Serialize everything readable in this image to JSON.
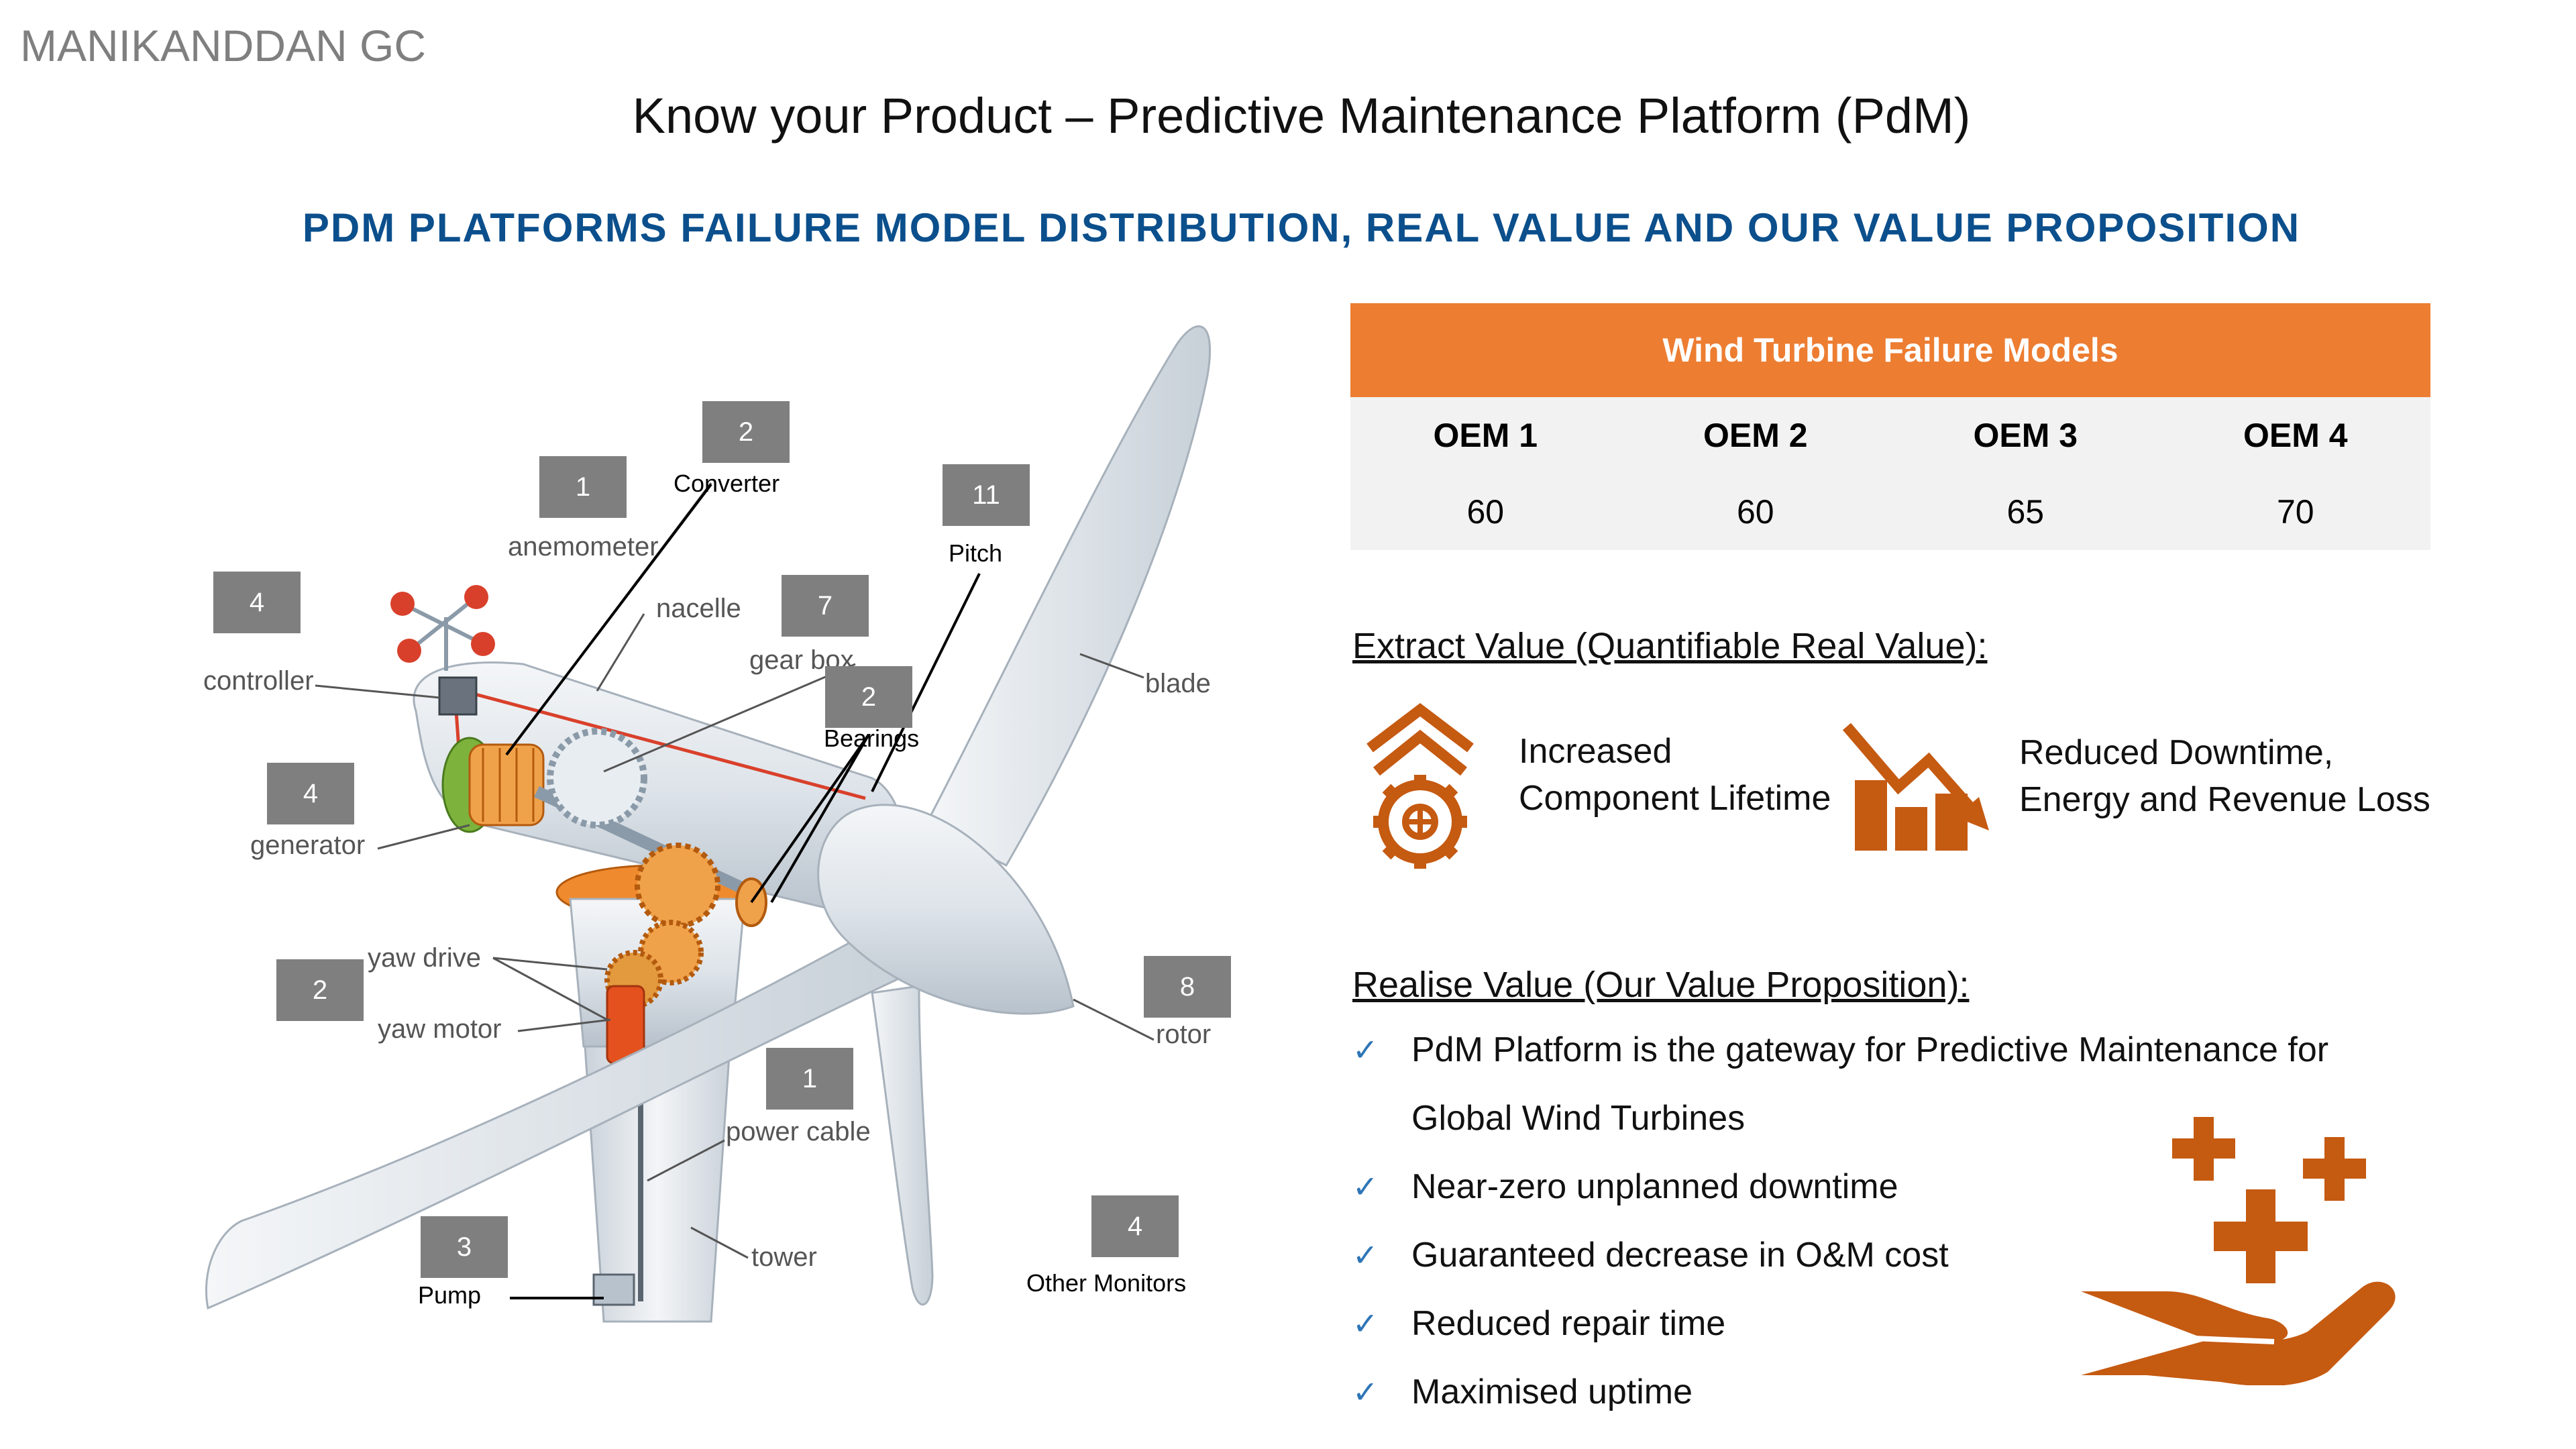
{
  "header": {
    "author": "MANIKANDDAN GC",
    "title": "Know your Product – Predictive Maintenance Platform (PdM)",
    "subtitle": "PDM PLATFORMS FAILURE MODEL DISTRIBUTION, REAL VALUE AND OUR VALUE PROPOSITION"
  },
  "diagram": {
    "parts": {
      "anemometer": "anemometer",
      "nacelle": "nacelle",
      "controller": "controller",
      "gear_box": "gear box",
      "blade": "blade",
      "generator": "generator",
      "yaw_drive": "yaw drive",
      "yaw_motor": "yaw motor",
      "rotor": "rotor",
      "power_cable": "power cable",
      "tower": "tower"
    },
    "callouts": {
      "anemometer": {
        "count": "1"
      },
      "converter": {
        "count": "2",
        "label": "Converter"
      },
      "pitch": {
        "count": "11",
        "label": "Pitch"
      },
      "controller": {
        "count": "4"
      },
      "gearbox": {
        "count": "7"
      },
      "bearings": {
        "count": "2",
        "label": "Bearings"
      },
      "generator": {
        "count": "4"
      },
      "yaw": {
        "count": "2"
      },
      "rotor": {
        "count": "8"
      },
      "power_cable": {
        "count": "1"
      },
      "pump": {
        "count": "3",
        "label": "Pump"
      },
      "other_monitors": {
        "count": "4",
        "label": "Other Monitors"
      }
    }
  },
  "table": {
    "title": "Wind Turbine Failure Models",
    "headers": [
      "OEM 1",
      "OEM 2",
      "OEM 3",
      "OEM 4"
    ],
    "values": [
      "60",
      "60",
      "65",
      "70"
    ]
  },
  "extract": {
    "heading": "Extract Value (Quantifiable Real Value):",
    "item1_line1": "Increased",
    "item1_line2": "Component Lifetime",
    "item2_line1": "Reduced Downtime,",
    "item2_line2": "Energy and Revenue Loss"
  },
  "realise": {
    "heading": "Realise Value (Our Value Proposition):",
    "check": "✓",
    "bullets": [
      "PdM Platform is the gateway for Predictive Maintenance for",
      "Global Wind Turbines",
      "Near-zero unplanned downtime",
      "Guaranteed decrease in O&M cost",
      "Reduced repair time",
      "Maximised uptime"
    ]
  },
  "colors": {
    "accent_orange": "#ed7d31",
    "icon_orange": "#c55a11",
    "subtitle_blue": "#0b4f8c",
    "check_blue": "#2e75b6",
    "callout_gray": "#7f7f7f"
  }
}
